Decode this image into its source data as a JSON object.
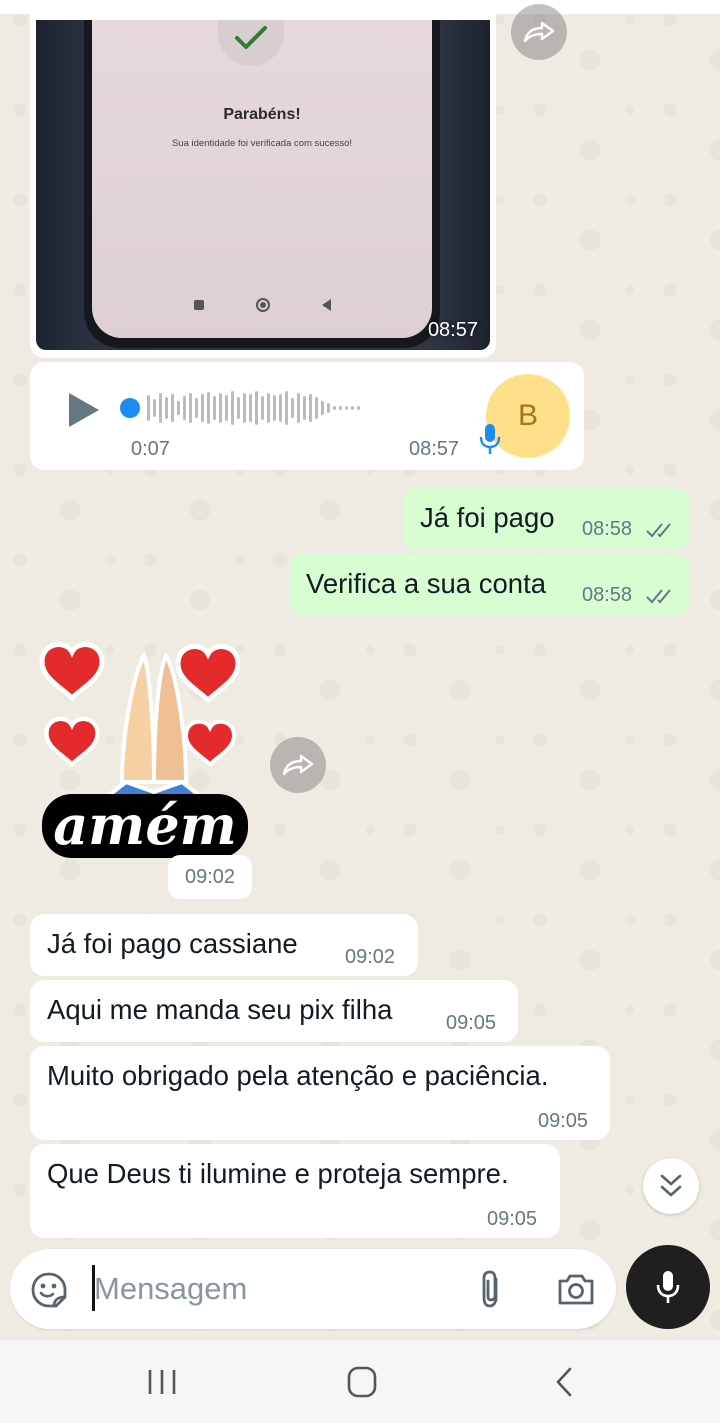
{
  "image_message": {
    "screen_title": "Parabéns!",
    "screen_subtitle": "Sua identidade foi verificada com sucesso!",
    "time": "08:57"
  },
  "voice_message": {
    "duration": "0:07",
    "time": "08:57",
    "avatar_initial": "B",
    "played_fraction": 0
  },
  "messages": [
    {
      "text": "Já foi pago",
      "time": "08:58",
      "direction": "out",
      "status": "read"
    },
    {
      "text": "Verifica a sua conta",
      "time": "08:58",
      "direction": "out",
      "status": "read"
    },
    {
      "text": "Já foi pago cassiane",
      "time": "09:02",
      "direction": "in"
    },
    {
      "text": "Aqui me manda seu pix filha",
      "time": "09:05",
      "direction": "in"
    },
    {
      "text": "Muito obrigado pela atenção e paciência.",
      "time": "09:05",
      "direction": "in"
    },
    {
      "text": "Que Deus ti ilumine e proteja sempre.",
      "time": "09:05",
      "direction": "in"
    }
  ],
  "sticker": {
    "text": "amém",
    "time": "09:02"
  },
  "composer": {
    "placeholder": "Mensagem"
  },
  "colors": {
    "incoming_bubble": "#ffffff",
    "outgoing_bubble": "#d9fdd3",
    "chat_background": "#efeae2",
    "voice_progress": "#1b8cf2",
    "mic_button": "#1f1f1f"
  },
  "icons": [
    "forward-icon",
    "play-icon",
    "mic-icon",
    "double-check-icon",
    "emoji-icon",
    "attach-icon",
    "camera-icon",
    "chevron-down-icon",
    "recents-icon",
    "home-icon",
    "back-icon"
  ]
}
